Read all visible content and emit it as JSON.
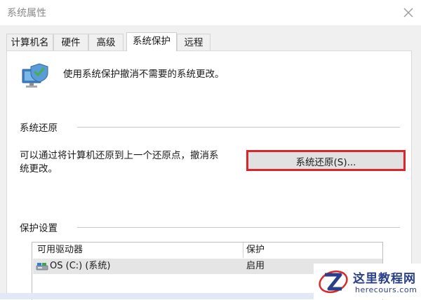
{
  "window": {
    "title": "系统属性",
    "close_glyph": "✕"
  },
  "tabs": [
    {
      "label": "计算机名",
      "active": false
    },
    {
      "label": "硬件",
      "active": false
    },
    {
      "label": "高级",
      "active": false
    },
    {
      "label": "系统保护",
      "active": true
    },
    {
      "label": "远程",
      "active": false
    }
  ],
  "intro": {
    "icon": "system-protection-icon",
    "text": "使用系统保护撤消不需要的系统更改。"
  },
  "restore": {
    "group_title": "系统还原",
    "line1": "可以通过将计算机还原到上一个还原点，撤消系",
    "line2": "统更改。",
    "button_label": "系统还原(S)...",
    "highlight_color": "#d9262b"
  },
  "protection": {
    "group_title": "保护设置",
    "columns": [
      "可用驱动器",
      "保护"
    ],
    "rows": [
      {
        "drive": "OS (C:) (系统)",
        "protection": "启用",
        "icon": "drive-icon"
      }
    ]
  },
  "watermark": {
    "title": "这里教程网",
    "url": "herecours.com",
    "logo": "z-logo"
  }
}
